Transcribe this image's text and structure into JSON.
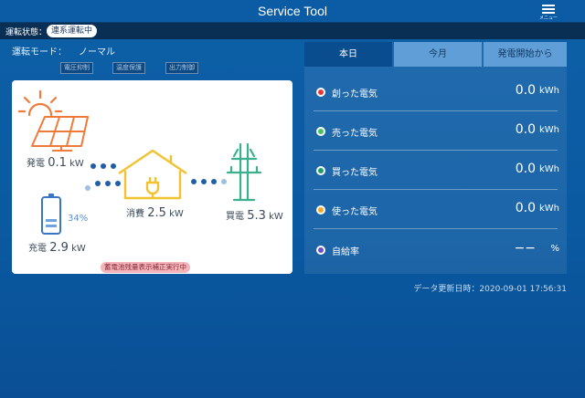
{
  "header": {
    "title": "Service Tool",
    "menu_label": "メニュー"
  },
  "status": {
    "label": "運転状態：",
    "badge": "連系運転中"
  },
  "mode": {
    "label": "運転モード：",
    "value": "ノーマル"
  },
  "indicators": [
    "電圧抑制",
    "温度保護",
    "出力制御"
  ],
  "flow": {
    "generation": {
      "label": "発電",
      "value": "0.1",
      "unit": "kW"
    },
    "consumption": {
      "label": "消費",
      "value": "2.5",
      "unit": "kW"
    },
    "purchase": {
      "label": "買電",
      "value": "5.3",
      "unit": "kW"
    },
    "battery": {
      "percent": "34%",
      "label": "充電",
      "value": "2.9",
      "unit": "kW",
      "level": 0.34
    },
    "correction_badge": "蓄電池残量表示補正実行中"
  },
  "tabs": [
    {
      "label": "本日",
      "active": true
    },
    {
      "label": "今月",
      "active": false
    },
    {
      "label": "発電開始から",
      "active": false
    }
  ],
  "stats": [
    {
      "label": "創った電気",
      "value": "0.0",
      "unit": "kWh",
      "color": "#e53935"
    },
    {
      "label": "売った電気",
      "value": "0.0",
      "unit": "kWh",
      "color": "#43c463"
    },
    {
      "label": "買った電気",
      "value": "0.0",
      "unit": "kWh",
      "color": "#1e9e6a"
    },
    {
      "label": "使った電気",
      "value": "0.0",
      "unit": "kWh",
      "color": "#f5a623"
    },
    {
      "label": "自給率",
      "value": "−−",
      "unit": "%",
      "color": "#6a4fc8"
    }
  ],
  "updated": "データ更新日時：2020-09-01 17:56:31",
  "colors": {
    "solar": "#f07a3a",
    "house": "#f2c230",
    "pole": "#3bb08f",
    "battery": "#3a74c4",
    "flow_dark": "#1e5fa8",
    "flow_light": "#9ec0e3"
  }
}
